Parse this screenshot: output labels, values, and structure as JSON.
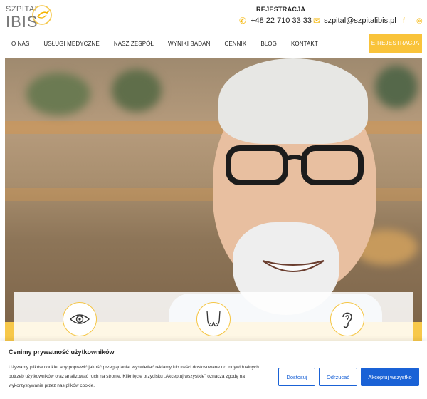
{
  "logo": {
    "line1": "SZPITAL",
    "line2": "IBIS"
  },
  "contact": {
    "registration_label": "REJESTRACJA",
    "phone": "+48 22 710 33 33",
    "email": "szpital@szpitalibis.pl",
    "phone_icon": "phone-icon",
    "email_icon": "envelope-icon"
  },
  "social": {
    "facebook": "f",
    "instagram": "◎"
  },
  "nav": {
    "items": [
      "O NAS",
      "USŁUGI MEDYCZNE",
      "NASZ ZESPÓŁ",
      "WYNIKI BADAŃ",
      "CENNIK",
      "BLOG",
      "KONTAKT"
    ],
    "cta": "E-REJESTRACJA"
  },
  "services": {
    "icons": [
      "eye-icon",
      "breast-icon",
      "ear-icon"
    ]
  },
  "cookie": {
    "title": "Cenimy prywatność użytkowników",
    "text": "Używamy plików cookie, aby poprawić jakość przeglądania, wyświetlać reklamy lub treści dostosowane do indywidualnych potrzeb użytkowników oraz analizować ruch na stronie. Kliknięcie przycisku „Akceptuj wszystkie” oznacza zgodę na wykorzystywanie przez nas plików cookie.",
    "btn_customize": "Dostosuj",
    "btn_reject": "Odrzucać",
    "btn_accept": "Akceptuj wszystko"
  },
  "colors": {
    "accent": "#f9c33a",
    "primary_blue": "#1a62d6"
  }
}
